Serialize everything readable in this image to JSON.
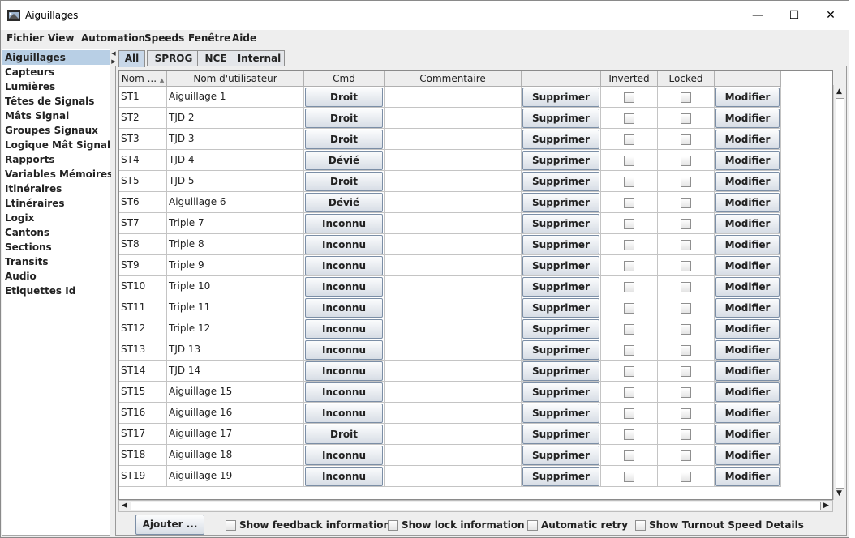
{
  "window": {
    "title": "Aiguillages",
    "controls": {
      "minimize": "—",
      "maximize": "☐",
      "close": "✕"
    }
  },
  "menu": [
    "Fichier",
    "View",
    "Automation",
    "Speeds",
    "Fenêtre",
    "Aide"
  ],
  "sidebar": {
    "items": [
      "Aiguillages",
      "Capteurs",
      "Lumières",
      "Têtes de Signals",
      "Mâts Signal",
      "Groupes Signaux",
      "Logique Mât Signal",
      "Rapports",
      "Variables Mémoires",
      "Itinéraires",
      "Ltinéraires",
      "Logix",
      "Cantons",
      "Sections",
      "Transits",
      "Audio",
      "Etiquettes Id"
    ],
    "selected": "Aiguillages"
  },
  "tabs": [
    "All",
    "SPROG",
    "NCE",
    "Internal"
  ],
  "active_tab": "All",
  "table": {
    "columns": [
      "Nom ...",
      "Nom d'utilisateur",
      "Cmd",
      "Commentaire",
      "",
      "Inverted",
      "Locked",
      ""
    ],
    "sort_indicator": "▲",
    "delete_label": "Supprimer",
    "edit_label": "Modifier",
    "rows": [
      {
        "name": "ST1",
        "user": "Aiguillage 1",
        "cmd": "Droit",
        "comment": ""
      },
      {
        "name": "ST2",
        "user": "TJD 2",
        "cmd": "Droit",
        "comment": ""
      },
      {
        "name": "ST3",
        "user": "TJD 3",
        "cmd": "Droit",
        "comment": ""
      },
      {
        "name": "ST4",
        "user": "TJD 4",
        "cmd": "Dévié",
        "comment": ""
      },
      {
        "name": "ST5",
        "user": "TJD 5",
        "cmd": "Droit",
        "comment": ""
      },
      {
        "name": "ST6",
        "user": "Aiguillage 6",
        "cmd": "Dévié",
        "comment": ""
      },
      {
        "name": "ST7",
        "user": "Triple 7",
        "cmd": "Inconnu",
        "comment": ""
      },
      {
        "name": "ST8",
        "user": "Triple 8",
        "cmd": "Inconnu",
        "comment": ""
      },
      {
        "name": "ST9",
        "user": "Triple 9",
        "cmd": "Inconnu",
        "comment": ""
      },
      {
        "name": "ST10",
        "user": "Triple 10",
        "cmd": "Inconnu",
        "comment": ""
      },
      {
        "name": "ST11",
        "user": "Triple 11",
        "cmd": "Inconnu",
        "comment": ""
      },
      {
        "name": "ST12",
        "user": "Triple 12",
        "cmd": "Inconnu",
        "comment": ""
      },
      {
        "name": "ST13",
        "user": "TJD 13",
        "cmd": "Inconnu",
        "comment": ""
      },
      {
        "name": "ST14",
        "user": "TJD 14",
        "cmd": "Inconnu",
        "comment": ""
      },
      {
        "name": "ST15",
        "user": "Aiguillage 15",
        "cmd": "Inconnu",
        "comment": ""
      },
      {
        "name": "ST16",
        "user": "Aiguillage 16",
        "cmd": "Inconnu",
        "comment": ""
      },
      {
        "name": "ST17",
        "user": "Aiguillage 17",
        "cmd": "Droit",
        "comment": ""
      },
      {
        "name": "ST18",
        "user": "Aiguillage 18",
        "cmd": "Inconnu",
        "comment": ""
      },
      {
        "name": "ST19",
        "user": "Aiguillage 19",
        "cmd": "Inconnu",
        "comment": ""
      }
    ]
  },
  "bottom": {
    "add_button": "Ajouter ...",
    "checks": [
      "Show feedback information",
      "Show lock information",
      "Automatic retry",
      "Show Turnout Speed Details"
    ]
  }
}
